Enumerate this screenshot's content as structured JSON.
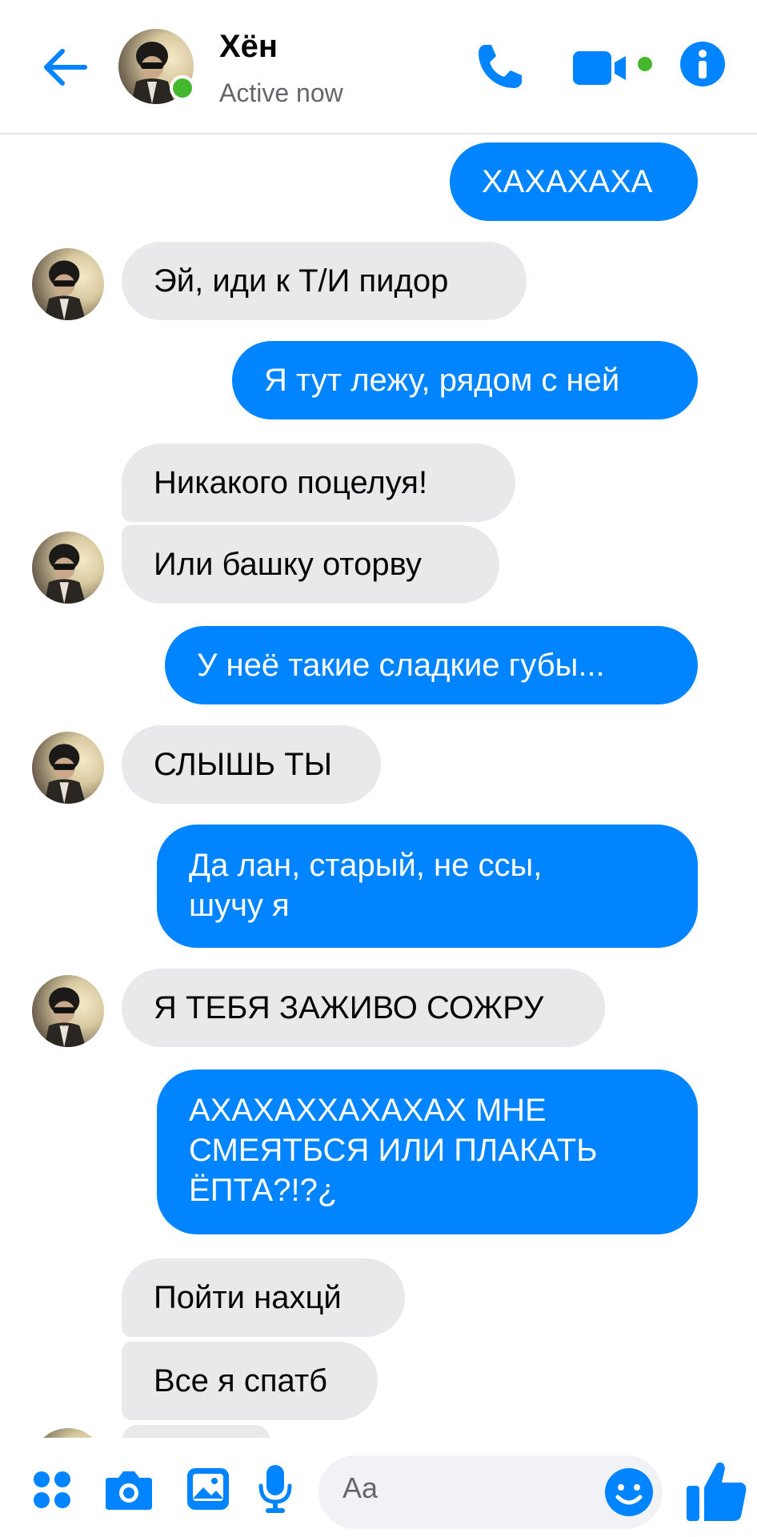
{
  "header": {
    "contact_name": "Хён",
    "status": "Active now",
    "accent_color": "#0084ff",
    "online_color": "#44b72e",
    "icons": [
      "back-arrow-icon",
      "phone-icon",
      "video-camera-icon",
      "info-icon"
    ]
  },
  "messages": [
    {
      "side": "out",
      "text": "ХАХАХАХА"
    },
    {
      "side": "in",
      "text": "Эй, иди к Т/И пидор"
    },
    {
      "side": "out",
      "text": "Я тут лежу, рядом с ней"
    },
    {
      "side": "in",
      "text": "Никакого поцелуя!"
    },
    {
      "side": "in",
      "text": "Или башку оторву"
    },
    {
      "side": "out",
      "text": "У неё такие сладкие губы..."
    },
    {
      "side": "in",
      "text": "СЛЫШЬ ТЫ"
    },
    {
      "side": "out",
      "text": "Да лан, старый, не ссы,\nшучу я"
    },
    {
      "side": "in",
      "text": "Я ТЕБЯ ЗАЖИВО СОЖРУ"
    },
    {
      "side": "out",
      "text": "АХАХАХХАХАХАХ МНЕ\nСМЕЯТБСЯ ИЛИ ПЛАКАТЬ\nЁПТА?!?¿"
    },
    {
      "side": "in",
      "text": "Пойти нахцй"
    },
    {
      "side": "in",
      "text": "Все я спатб"
    }
  ],
  "composer": {
    "placeholder": "Aa",
    "icons": [
      "apps-menu-icon",
      "camera-icon",
      "gallery-icon",
      "microphone-icon",
      "emoji-icon",
      "thumbs-up-icon"
    ]
  }
}
